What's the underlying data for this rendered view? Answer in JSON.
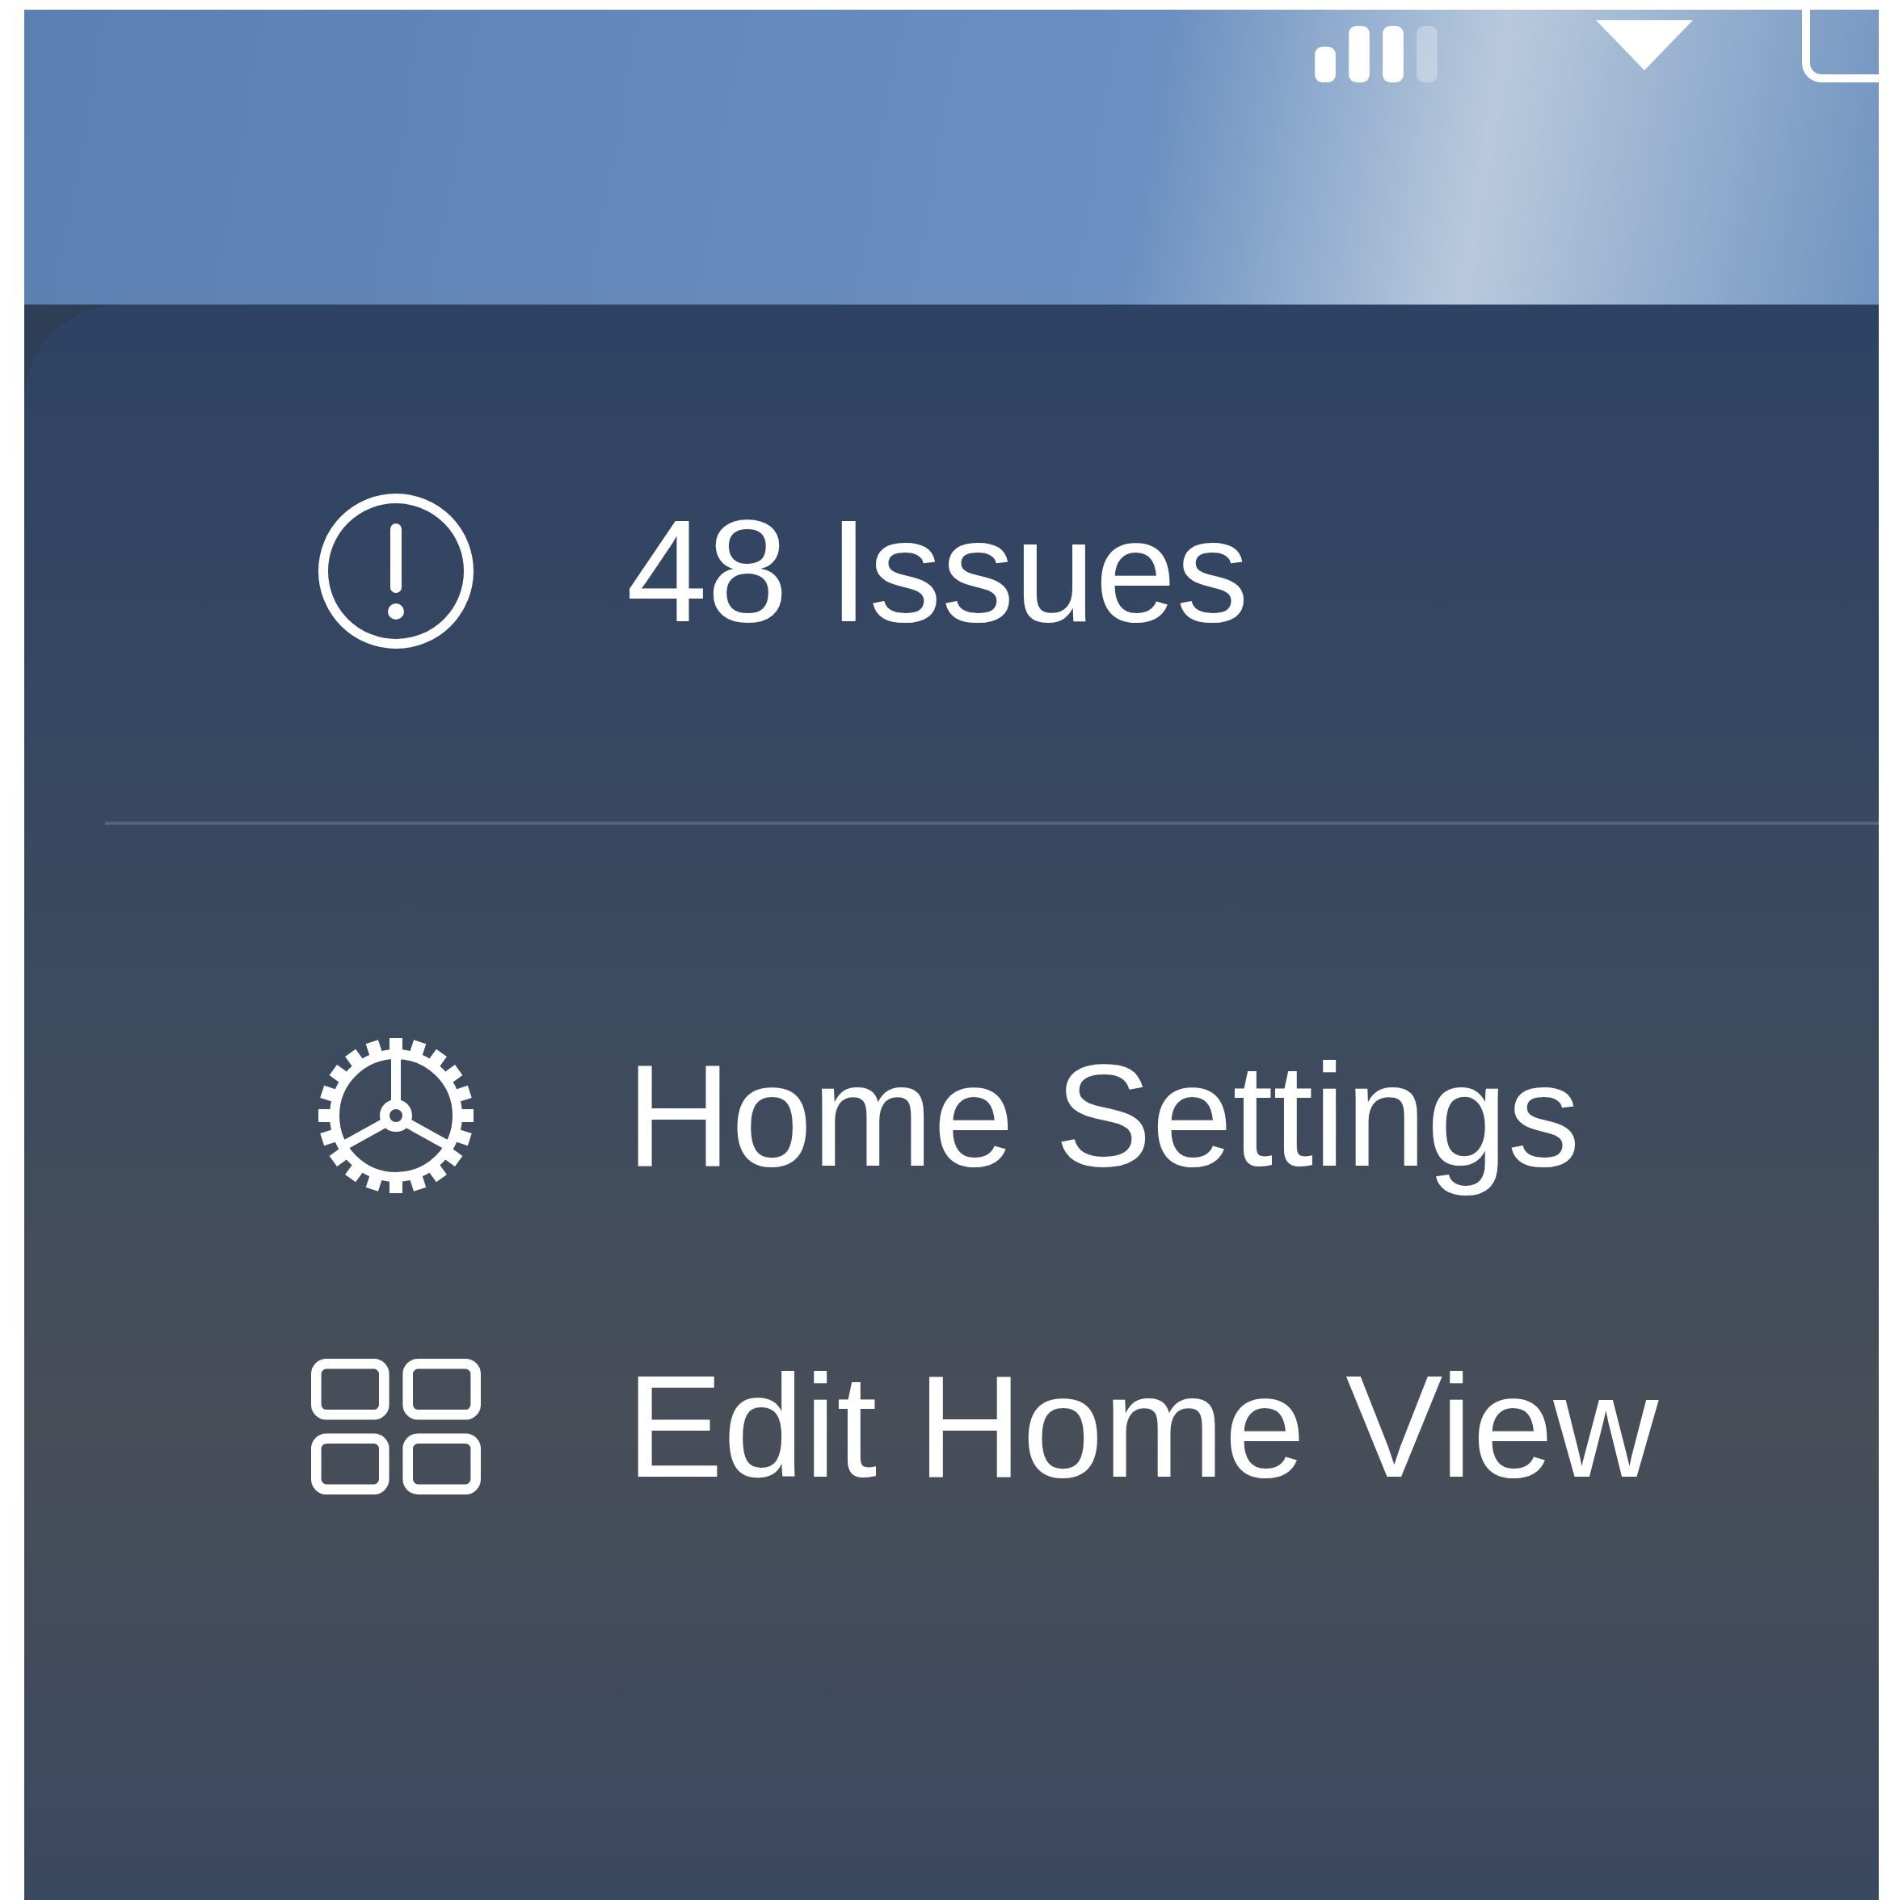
{
  "menu": {
    "sections": [
      {
        "items": [
          {
            "kind": "issues",
            "label": "48 Issues"
          }
        ]
      },
      {
        "items": [
          {
            "kind": "settings",
            "label": "Home Settings"
          },
          {
            "kind": "edit",
            "label": "Edit Home View"
          }
        ]
      }
    ]
  }
}
